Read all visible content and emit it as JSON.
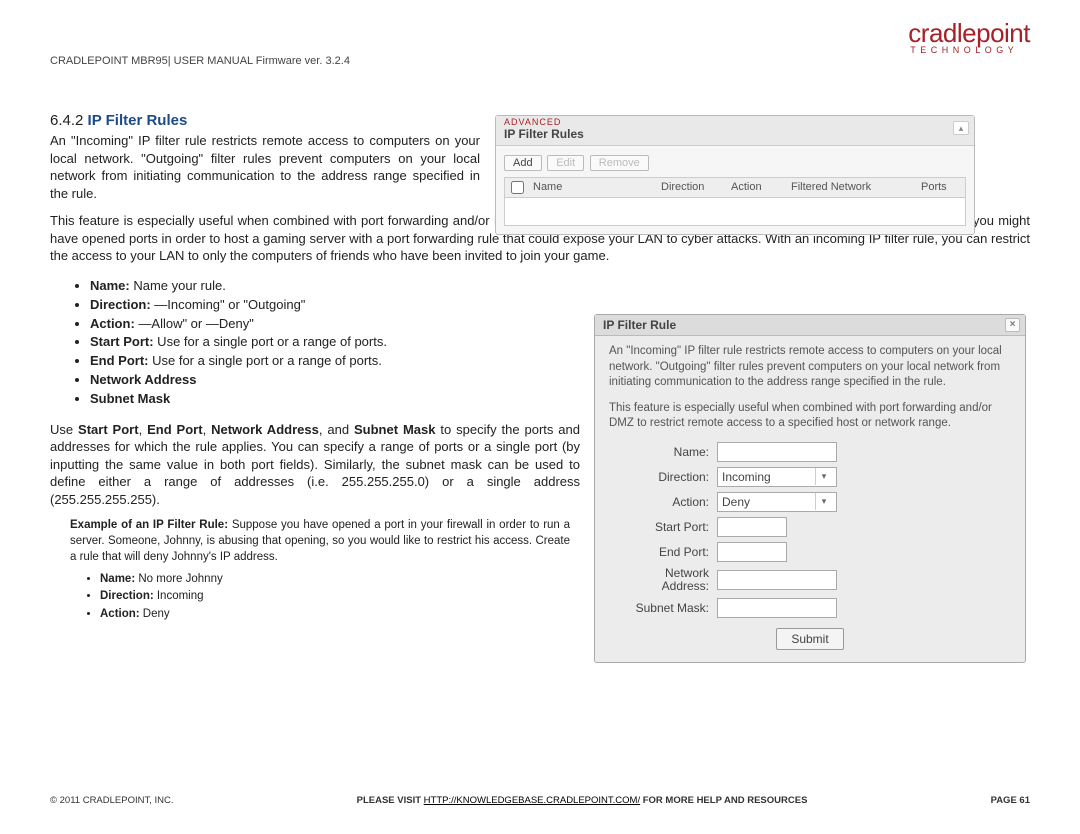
{
  "logo": {
    "main": "cradlepoint",
    "sub": "TECHNOLOGY"
  },
  "header_line": "CRADLEPOINT MBR95| USER MANUAL Firmware ver. 3.2.4",
  "section": {
    "number": "6.4.2",
    "title": "IP Filter Rules"
  },
  "para1": "An \"Incoming\" IP filter rule restricts remote access to computers on your local network. \"Outgoing\" filter rules prevent computers on your local network from initiating communication to the address range specified in the rule.",
  "para_full": "This feature is especially useful when combined with port forwarding and/or DMZ to restrict remote access to a specified host or network range. For example, you might have opened ports in order to host a gaming server with a port forwarding rule that could expose your LAN to cyber attacks. With an incoming IP filter rule, you can restrict the access to your LAN to only the computers of friends who have been invited to join your game.",
  "bullets": {
    "name_b": "Name:",
    "name_t": " Name your rule.",
    "dir_b": "Direction:",
    "dir_t": " ―Incoming\" or \"Outgoing\"",
    "act_b": "Action:",
    "act_t": " ―Allow\" or ―Deny\"",
    "sp_b": "Start Port:",
    "sp_t": " Use for a single port or a range of ports.",
    "ep_b": "End Port:",
    "ep_t": " Use for a single port or a range of ports.",
    "na_b": "Network Address",
    "sm_b": "Subnet Mask"
  },
  "para2a": "Use ",
  "para2_sp": "Start Port",
  "para2b": ", ",
  "para2_ep": "End Port",
  "para2c": ", ",
  "para2_na": "Network Address",
  "para2d": ", and ",
  "para2_sm": "Subnet Mask",
  "para2e": " to specify the ports and addresses for which the rule applies. You can specify a range of ports or a single port (by inputting the same value in both port fields). Similarly, the subnet mask can be used to define either a range of addresses (i.e. 255.255.255.0) or a single address (255.255.255.255).",
  "example_b": "Example of an IP Filter Rule:",
  "example_t": " Suppose you have opened a port in your firewall in order to run a server. Someone, Johnny, is abusing that opening, so you would like to restrict his access. Create a rule that will deny Johnny's IP address.",
  "exb": {
    "n_b": "Name:",
    "n_t": " No more Johnny",
    "d_b": "Direction:",
    "d_t": " Incoming",
    "a_b": "Action:",
    "a_t": " Deny"
  },
  "panel1": {
    "adv": "ADVANCED",
    "title": "IP Filter Rules",
    "add": "Add",
    "edit": "Edit",
    "remove": "Remove",
    "hname": "Name",
    "hdir": "Direction",
    "hact": "Action",
    "hnet": "Filtered Network",
    "hports": "Ports",
    "collapse": "▴"
  },
  "panel2": {
    "title": "IP Filter Rule",
    "close": "×",
    "p1": "An \"Incoming\" IP filter rule restricts remote access to computers on your local network. \"Outgoing\" filter rules prevent computers on your local network from initiating communication to the address range specified in the rule.",
    "p2": "This feature is especially useful when combined with port forwarding and/or DMZ to restrict remote access to a specified host or network range.",
    "l_name": "Name:",
    "l_dir": "Direction:",
    "v_dir": "Incoming",
    "l_act": "Action:",
    "v_act": "Deny",
    "l_sp": "Start Port:",
    "l_ep": "End Port:",
    "l_na": "Network Address:",
    "l_sm": "Subnet Mask:",
    "submit": "Submit"
  },
  "footer": {
    "left": "© 2011 CRADLEPOINT, INC.",
    "mid1": "PLEASE VISIT ",
    "mid_link": "HTTP://KNOWLEDGEBASE.CRADLEPOINT.COM/",
    "mid2": " FOR MORE HELP AND RESOURCES",
    "right": "PAGE 61"
  }
}
